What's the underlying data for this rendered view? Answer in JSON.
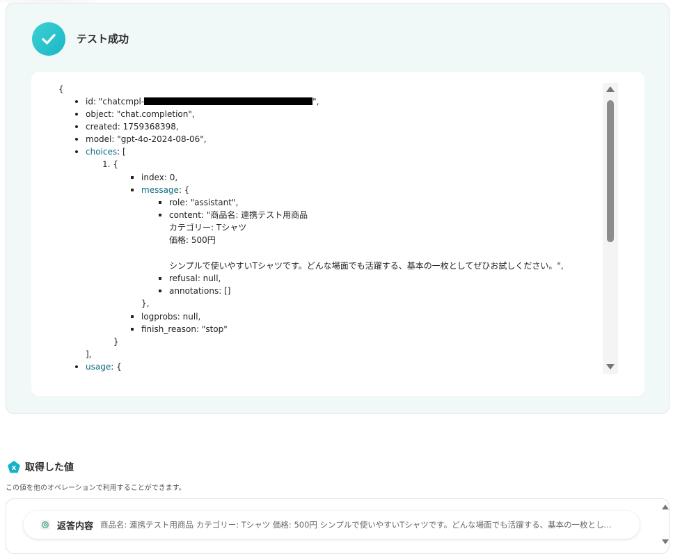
{
  "result": {
    "title": "テスト成功",
    "json": {
      "open_brace": "{",
      "id_prefix": "id: \"chatcmpl-",
      "id_suffix": "\",",
      "object": "object: \"chat.completion\",",
      "created": "created: 1759368398,",
      "model": "model: \"gpt-4o-2024-08-06\",",
      "choices_key": "choices",
      "choices_open": ": [",
      "item_number": "1.",
      "item_open": "{",
      "index": "index: 0,",
      "message_key": "message",
      "message_open": ": {",
      "role": "role: \"assistant\",",
      "content_line1": "content: \"商品名: 連携テスト用商品",
      "content_line2": "カテゴリー: Tシャツ",
      "content_line3": "価格: 500円",
      "content_line4": "シンプルで使いやすいTシャツです。どんな場面でも活躍する、基本の一枚としてぜひお試しください。\",",
      "refusal": "refusal: null,",
      "annotations": "annotations: []",
      "message_close": "},",
      "logprobs": "logprobs: null,",
      "finish_reason": "finish_reason: \"stop\"",
      "item_close": "}",
      "choices_close": "],",
      "usage_key": "usage",
      "usage_open": ": {"
    }
  },
  "variables": {
    "title": "取得した値",
    "description": "この値を他のオペレーションで利用することができます。",
    "items": [
      {
        "icon": "openai-icon",
        "label": "返答内容",
        "value": "商品名: 連携テスト用商品 カテゴリー: Tシャツ 価格: 500円 シンプルで使いやすいTシャツです。どんな場面でも活躍する、基本の一枚としてぜひお試しください。"
      }
    ]
  },
  "colors": {
    "success_gradient_start": "#3fd0d4",
    "success_gradient_end": "#18b7c6",
    "card_background": "#f1f9f8",
    "json_key_link": "#0f6c82",
    "variable_icon": "#16b3c8"
  }
}
